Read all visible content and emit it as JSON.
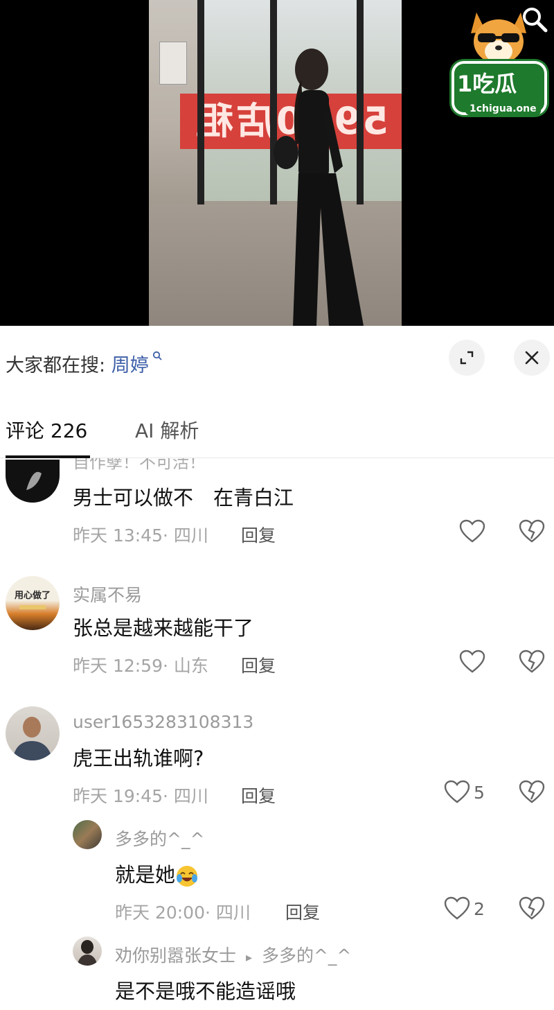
{
  "logo": {
    "brand": "1吃瓜",
    "url": "1chigua.one"
  },
  "search": {
    "prefix": "大家都在搜:",
    "keyword": "周婷",
    "keyword_icon": "search-icon"
  },
  "header_icons": {
    "expand": "expand-icon",
    "close": "close-icon"
  },
  "tabs": [
    {
      "label": "评论 226",
      "active": true
    },
    {
      "label": "AI 解析",
      "active": false
    }
  ],
  "cut_text": "自作孽！不可活！",
  "comments": [
    {
      "username": "",
      "text": "男士可以做不　在青白江",
      "meta": "昨天 13:45· 四川",
      "reply_label": "回复",
      "likes": ""
    },
    {
      "username": "实属不易",
      "avatar_text": "用心做了",
      "text": "张总是越来越能干了",
      "meta": "昨天 12:59· 山东",
      "reply_label": "回复",
      "likes": ""
    },
    {
      "username": "user1653283108313",
      "text": "虎王出轨谁啊?",
      "meta": "昨天 19:45· 四川",
      "reply_label": "回复",
      "likes": "5"
    }
  ],
  "replies": [
    {
      "username": "多多的^_^",
      "text": "就是她",
      "emoji": "laughing-crying-emoji",
      "meta": "昨天 20:00· 四川",
      "reply_label": "回复",
      "likes": "2"
    },
    {
      "username": "劝你别嚣张女士",
      "reply_to_arrow": "▸",
      "reply_to": "多多的^_^",
      "text": "是不是哦不能造谣哦"
    }
  ],
  "colors": {
    "keyword": "#3c5ea8",
    "meta": "#a5a5a5",
    "logo_green": "#1e7a2c"
  }
}
